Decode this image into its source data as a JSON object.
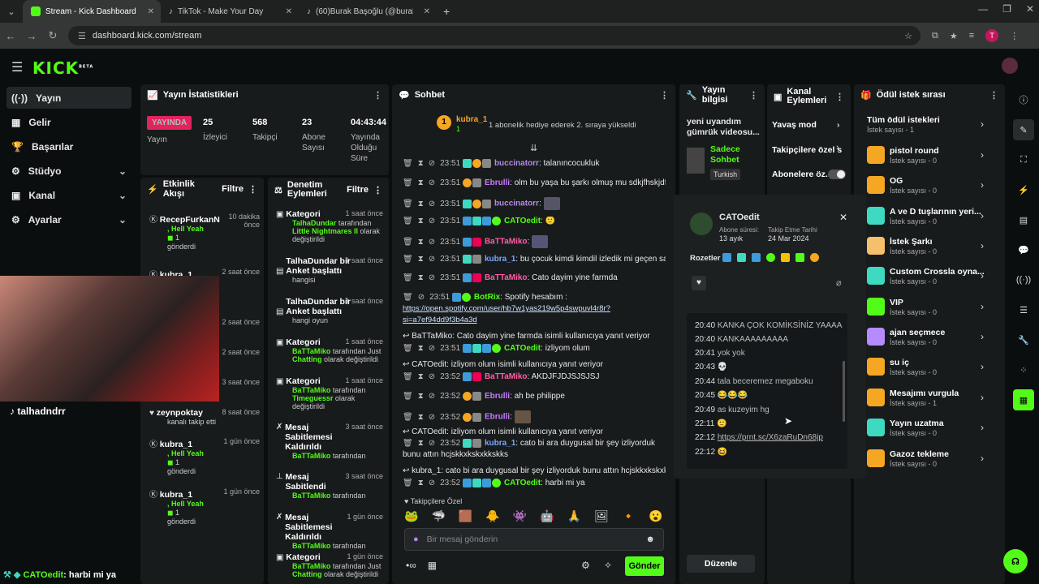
{
  "browser": {
    "tabs": [
      {
        "title": "Stream - Kick Dashboard"
      },
      {
        "title": "TikTok - Make Your Day"
      },
      {
        "title": "(60)Burak Başoğlu (@burak.bas"
      }
    ],
    "url": "dashboard.kick.com/stream"
  },
  "app": {
    "logo": "KICK",
    "beta": "BETA"
  },
  "sidebar": [
    {
      "label": "Yayın"
    },
    {
      "label": "Gelir"
    },
    {
      "label": "Başarılar"
    },
    {
      "label": "Stüdyo"
    },
    {
      "label": "Kanal"
    },
    {
      "label": "Ayarlar"
    }
  ],
  "stats": {
    "title": "Yayın İstatistikleri",
    "live": "YAYINDA",
    "live_label": "Yayın",
    "viewers": "25",
    "viewers_label": "İzleyici",
    "followers": "568",
    "followers_label": "Takipçi",
    "subs": "23",
    "subs_label": "Abone Sayısı",
    "uptime": "04:43:44",
    "uptime_label": "Yayında Olduğu Süre"
  },
  "activity": {
    "title": "Etkinlik Akışı",
    "filter": "Filtre",
    "items": [
      {
        "name": "RecepFurkanN",
        "msg": ", Hell Yeah",
        "count": "1",
        "sent": "gönderdi",
        "time": "10 dakika önce"
      },
      {
        "name": "kubra_1",
        "time": "2 saat önce"
      },
      {
        "time": "2 saat önce"
      },
      {
        "time": "2 saat önce"
      },
      {
        "time": "3 saat önce"
      },
      {
        "name": "zeynpoktay",
        "msg": "kanalı takip etti",
        "time": "8 saat önce"
      },
      {
        "name": "kubra_1",
        "msg": ", Hell Yeah",
        "count": "1",
        "sent": "gönderdi",
        "time": "1 gün önce"
      },
      {
        "name": "kubra_1",
        "msg": ", Hell Yeah",
        "count": "1",
        "sent": "gönderdi",
        "time": "1 gün önce"
      }
    ]
  },
  "moderation": {
    "title": "Denetim Eylemleri",
    "filter": "Filtre",
    "items": [
      {
        "title": "Kategori",
        "line1": "TalhaDundar",
        "line1b": " tarafından",
        "line2": "Little Nightmares II",
        "line2b": " olarak",
        "line3": "değiştirildi",
        "time": "1 saat önce"
      },
      {
        "title": "TalhaDundar bir Anket başlattı",
        "line3": "hangisi",
        "time": "1 saat önce"
      },
      {
        "title": "TalhaDundar bir Anket başlattı",
        "line3": "hangi oyun",
        "time": "1 saat önce"
      },
      {
        "title": "Kategori",
        "line1": "BaTTaMiko",
        "line1b": " tarafından Just",
        "line2": "Chatting",
        "line2b": " olarak değiştirildi",
        "time": "1 saat önce"
      },
      {
        "title": "Kategori",
        "line1": "BaTTaMiko",
        "line1b": " tarafından",
        "line2": "Timeguessr",
        "line2b": " olarak",
        "line3": "değiştirildi",
        "time": "1 saat önce"
      },
      {
        "title": "Mesaj Sabitlemesi Kaldırıldı",
        "line1": "BaTTaMiko",
        "line1b": " tarafından",
        "time": "3 saat önce"
      },
      {
        "title": "Mesaj Sabitlendi",
        "line1": "BaTTaMiko",
        "line1b": " tarafından",
        "time": "3 saat önce"
      },
      {
        "title": "Mesaj Sabitlemesi Kaldırıldı",
        "line1": "BaTTaMiko",
        "line1b": " tarafından",
        "time": "1 gün önce"
      },
      {
        "title": "Kategori",
        "line1": "BaTTaMiko",
        "line1b": " tarafından Just",
        "line2": "Chatting",
        "line2b": " olarak değiştirildi",
        "time": "1 gün önce"
      }
    ]
  },
  "chat": {
    "title": "Sohbet",
    "pinned_user": "kubra_1",
    "pinned_count": "1",
    "pinned_msg": "1 abonelik hediye ederek 2. sıraya yükseldi",
    "messages": [
      {
        "time": "23:51",
        "user": "buccinatorr",
        "color": "#b48ae6",
        "text": "talanıncocukluk"
      },
      {
        "time": "23:51",
        "user": "Ebrulli",
        "color": "#c77dff",
        "text": "olm bu yaşa bu şarkı olmuş mu sdkjfhskjdf"
      },
      {
        "time": "23:51",
        "user": "buccinatorr",
        "color": "#b48ae6",
        "text": ""
      },
      {
        "time": "23:51",
        "user": "CATOedit",
        "color": "#53fc18",
        "text": ""
      },
      {
        "time": "23:51",
        "user": "BaTTaMiko",
        "color": "#ff5ea8",
        "text": ""
      },
      {
        "time": "23:51",
        "user": "kubra_1",
        "color": "#7aa7ff",
        "text": "bu çocuk kimdi kimdil izledik mi geçen sankil"
      },
      {
        "time": "23:51",
        "user": "BaTTaMiko",
        "color": "#ff5ea8",
        "text": "Cato dayim yine farmda"
      },
      {
        "time": "23:51",
        "user": "BotRix",
        "color": "#53fc18",
        "text": "Spotify hesabım :"
      }
    ],
    "spotify1": "https://open.spotify.com/user/hb7w1yas219w5p4swpuvl4r8r?",
    "spotify2": "si=a7ef94dd9f3b4a3d",
    "reply1": "BaTTaMiko: Cato dayim yine farmda isimli kullanıcıya yanıt veriyor",
    "m9": {
      "time": "23:51",
      "user": "CATOedit",
      "text": "izliyom olum"
    },
    "reply2": "CATOedit: izliyom olum isimli kullanıcıya yanıt veriyor",
    "m10": {
      "time": "23:52",
      "user": "BaTTaMiko",
      "text": "AKDJFJDJSJSJSJ"
    },
    "m11": {
      "time": "23:52",
      "user": "Ebrulli",
      "text": "ah be philippe"
    },
    "m12": {
      "time": "23:52",
      "user": "Ebrulli",
      "text": ""
    },
    "reply3": "CATOedit: izliyom olum isimli kullanıcıya yanıt veriyor",
    "m13": {
      "time": "23:52",
      "user": "kubra_1",
      "text": "cato bi ara duygusal bir şey izliyorduk"
    },
    "m13b": "bunu attın hcjskkxkskxkkskks",
    "reply4": "kubra_1: cato bi ara duygusal bir şey izliyorduk  bunu attın hcjskkxkskxkkks...",
    "m14": {
      "time": "23:52",
      "user": "CATOedit",
      "text": "harbi mi ya"
    },
    "emote_label": "Takipçilere Özel",
    "placeholder": "Bir mesaj gönderin",
    "send": "Gönder"
  },
  "info": {
    "title": "Yayın bilgisi",
    "stream_title": "yeni uyandım gümrük videosu...",
    "category": "Sadece Sohbet",
    "lang": "Turkish",
    "edit": "Düzenle"
  },
  "channel": {
    "title": "Kanal Eylemleri",
    "items": [
      {
        "label": "Yavaş mod"
      },
      {
        "label": "Takipçilere özel s"
      },
      {
        "label": "Abonelere öz..."
      }
    ]
  },
  "rewards": {
    "title": "Ödül istek sırası",
    "all": "Tüm ödül istekleri",
    "all_count": "İstek sayısı - 1",
    "items": [
      {
        "name": "pistol round",
        "count": "İstek sayısı - 0",
        "color": "#f5a623"
      },
      {
        "name": "OG",
        "count": "İstek sayısı - 0",
        "color": "#f5a623"
      },
      {
        "name": "A ve D tuşlarının yeri...",
        "count": "İstek sayısı - 0",
        "color": "#3dd9c1"
      },
      {
        "name": "İstek Şarkı",
        "count": "İstek sayısı - 0",
        "color": "#f5c06b"
      },
      {
        "name": "Custom Crossla oyna...",
        "count": "İstek sayısı - 0",
        "color": "#3dd9c1"
      },
      {
        "name": "VIP",
        "count": "İstek sayısı - 0",
        "color": "#53fc18"
      },
      {
        "name": "ajan seçmece",
        "count": "İstek sayısı - 0",
        "color": "#b58cff"
      },
      {
        "name": "su iç",
        "count": "İstek sayısı - 0",
        "color": "#f5a623"
      },
      {
        "name": "Mesajımı vurgula",
        "count": "İstek sayısı - 1",
        "color": "#f5a623"
      },
      {
        "name": "Yayın uzatma",
        "count": "İstek sayısı - 0",
        "color": "#3dd9c1"
      },
      {
        "name": "Gazoz tekleme",
        "count": "İstek sayısı - 0",
        "color": "#f5a623"
      }
    ]
  },
  "popup": {
    "user": "CATOedit",
    "sub_label": "Abone süresi:",
    "sub_val": "13 ayık",
    "follow_label": "Takip Etme Tarihi",
    "follow_val": "24 Mar 2024",
    "badges_label": "Rozetler",
    "history": [
      {
        "time": "20:40",
        "text": "KANKA ÇOK KOMİKSİNİZ YAAAA"
      },
      {
        "time": "20:40",
        "text": "KANKAAAAAAAAA"
      },
      {
        "time": "20:41",
        "text": "yok yok"
      },
      {
        "time": "20:43",
        "text": ""
      },
      {
        "time": "20:44",
        "text": "tala becеremez megaboku"
      },
      {
        "time": "20:45",
        "text": ""
      },
      {
        "time": "20:49",
        "text": "as kuzeyim hg"
      },
      {
        "time": "22:11",
        "text": ""
      },
      {
        "time": "22:12",
        "text": "https://prnt.sc/X6zaRuDn68jp"
      },
      {
        "time": "22:12",
        "text": ""
      }
    ]
  },
  "overlay": {
    "tiktok": "talhadndrr",
    "bottom_user": "CATOedit",
    "bottom_msg": ": harbi mi ya"
  }
}
